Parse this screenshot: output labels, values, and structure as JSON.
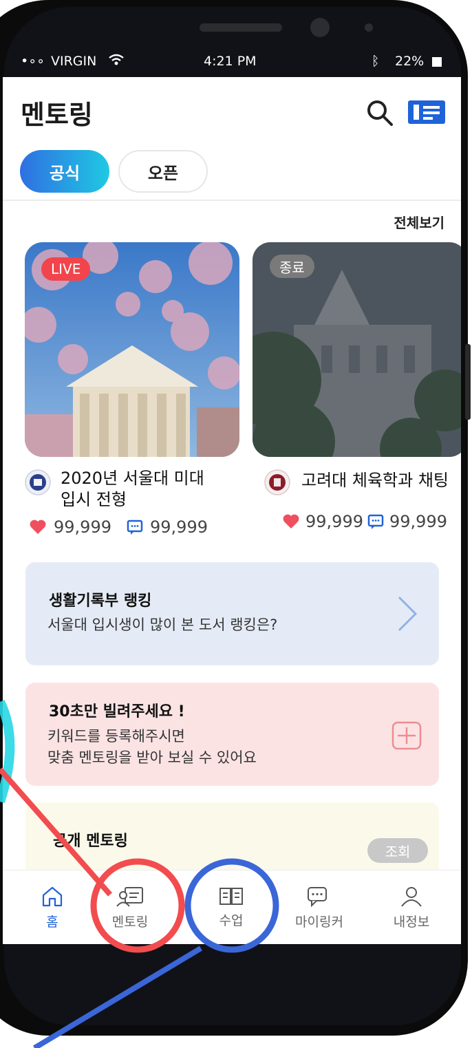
{
  "status": {
    "carrier": "VIRGIN",
    "time": "4:21 PM",
    "battery": "22%"
  },
  "header": {
    "title": "멘토링"
  },
  "tabs": [
    {
      "label": "공식",
      "active": true
    },
    {
      "label": "오픈",
      "active": false
    }
  ],
  "section": {
    "see_all": "전체보기"
  },
  "cards": [
    {
      "badge": "LIVE",
      "badge_color": "#f2444c",
      "title_line1": "2020년 서울대 미대",
      "title_line2": "입시 전형",
      "likes": "99,999",
      "comments": "99,999"
    },
    {
      "badge": "종료",
      "badge_color": "#7a7a7a",
      "title_line1": "고려대 체육학과 채팅",
      "likes": "99,999",
      "comments": "99,999"
    }
  ],
  "panels": {
    "record": {
      "title": "생활기록부 랭킹",
      "subtitle": "서울대 입시생이 많이 본 도서 랭킹은?"
    },
    "keyword": {
      "title": "30초만 빌려주세요 !",
      "line1": "키워드를 등록해주시면",
      "line2": "맞춤 멘토링을 받아 보실 수 있어요"
    },
    "public": {
      "title": "공개 멘토링",
      "button": "조회"
    }
  },
  "nav": [
    {
      "label": "홈",
      "icon": "home-icon"
    },
    {
      "label": "멘토링",
      "icon": "mentoring-icon"
    },
    {
      "label": "수업",
      "icon": "book-icon"
    },
    {
      "label": "마이링커",
      "icon": "chat-icon"
    },
    {
      "label": "내정보",
      "icon": "user-icon"
    }
  ],
  "colors": {
    "accent": "#1f63d8",
    "like": "#ef4f5e",
    "highlight_red": "#f24c4f",
    "highlight_blue": "#3b66d8"
  }
}
